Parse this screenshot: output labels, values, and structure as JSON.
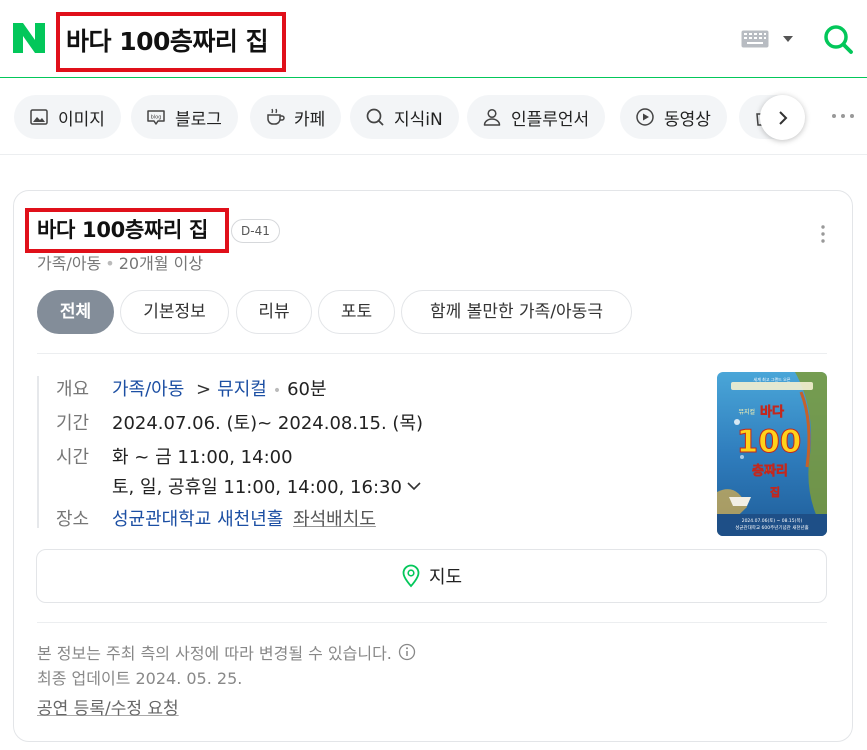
{
  "header": {
    "logo": "N",
    "query": "바다 100층짜리 집",
    "icons": [
      "keyboard-icon",
      "caret-down-icon",
      "search-icon"
    ],
    "brand_color": "#03c75a"
  },
  "tabs": [
    {
      "label": "이미지",
      "icon": "image-icon"
    },
    {
      "label": "블로그",
      "icon": "blog-icon"
    },
    {
      "label": "카페",
      "icon": "cafe-icon"
    },
    {
      "label": "지식iN",
      "icon": "knowledge-icon"
    },
    {
      "label": "인플루언서",
      "icon": "person-icon"
    },
    {
      "label": "동영상",
      "icon": "play-icon"
    }
  ],
  "card": {
    "title": "바다 100층짜리 집",
    "dday": "D-41",
    "genre": "가족/아동",
    "age": "20개월 이상",
    "subtabs": [
      "전체",
      "기본정보",
      "리뷰",
      "포토",
      "함께 볼만한 가족/아동극"
    ],
    "info": {
      "overview_label": "개요",
      "category": "가족/아동",
      "arrow": ">",
      "subcategory": "뮤지컬",
      "runtime": "60분",
      "period_label": "기간",
      "period": "2024.07.06. (토)~ 2024.08.15. (목)",
      "time_label": "시간",
      "time_weekday": "화 ~ 금 11:00, 14:00",
      "time_weekend": "토, 일, 공휴일 11:00, 14:00, 16:30",
      "venue_label": "장소",
      "venue": "성균관대학교 새천년홀",
      "seat_map": "좌석배치도"
    },
    "poster": {
      "top_caption": "세계 최고 그랜드 오픈",
      "musical": "뮤지컬",
      "title_1": "바다",
      "title_2": "100",
      "title_3": "층짜리",
      "title_4": "집",
      "dates": "2024.07.06(토) ~ 08.15(목)",
      "venue": "성균관대학교 600주년기념관 새천년홀"
    },
    "map_button": "지도",
    "notice": "본 정보는 주최 측의 사정에 따라 변경될 수 있습니다.",
    "updated": "최종 업데이트 2024. 05. 25.",
    "edit_link": "공연 등록/수정 요청"
  }
}
